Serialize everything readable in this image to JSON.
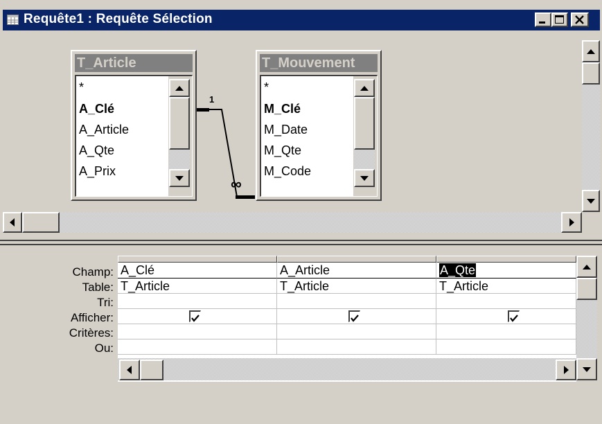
{
  "window": {
    "title": "Requête1 : Requête Sélection",
    "controls": [
      "minimize-icon",
      "maximize-icon",
      "close-icon"
    ]
  },
  "tables": [
    {
      "name": "T_Article",
      "fields": [
        {
          "label": "*",
          "bold": false
        },
        {
          "label": "A_Clé",
          "bold": true
        },
        {
          "label": "A_Article",
          "bold": false
        },
        {
          "label": "A_Qte",
          "bold": false
        },
        {
          "label": "A_Prix",
          "bold": false
        }
      ]
    },
    {
      "name": "T_Mouvement",
      "fields": [
        {
          "label": "*",
          "bold": false
        },
        {
          "label": "M_Clé",
          "bold": true
        },
        {
          "label": "M_Date",
          "bold": false
        },
        {
          "label": "M_Qte",
          "bold": false
        },
        {
          "label": "M_Code",
          "bold": false
        }
      ]
    }
  ],
  "relationship": {
    "one_label": "1",
    "many_label": "∞"
  },
  "grid": {
    "row_labels": [
      "Champ:",
      "Table:",
      "Tri:",
      "Afficher:",
      "Critères:",
      "Ou:"
    ],
    "columns": [
      {
        "champ": "A_Clé",
        "table": "T_Article",
        "tri": "",
        "afficher": true,
        "criteres": "",
        "ou": ""
      },
      {
        "champ": "A_Article",
        "table": "T_Article",
        "tri": "",
        "afficher": true,
        "criteres": "",
        "ou": ""
      },
      {
        "champ": "A_Qte",
        "table": "T_Article",
        "tri": "",
        "afficher": true,
        "criteres": "",
        "ou": "",
        "selected": true
      }
    ]
  },
  "colors": {
    "titlebar": "#0a2468",
    "face": "#d4d0c8"
  }
}
